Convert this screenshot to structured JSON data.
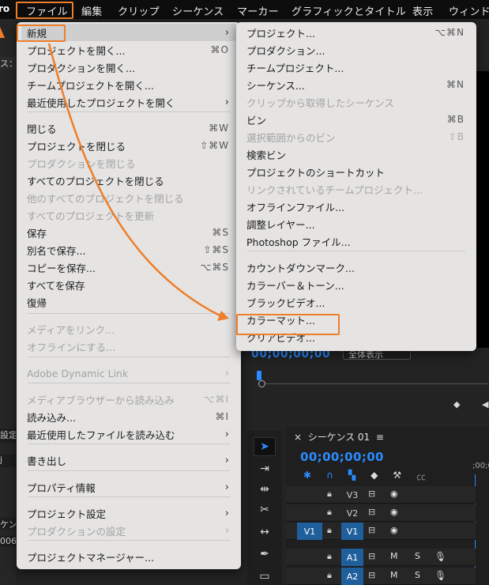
{
  "menubar": {
    "app_partial": "ro",
    "items": [
      "ファイル",
      "編集",
      "クリップ",
      "シーケンス",
      "マーカー",
      "グラフィックとタイトル",
      "表示",
      "ウィンド"
    ]
  },
  "background": {
    "left_cells": [
      "ス：(",
      "設定",
      "j",
      "ケンス",
      "006."
    ],
    "program_timecode": "00;00;00;00",
    "zoom_select": "全体表示",
    "sequence": {
      "tab_label": "シーケンス 01",
      "timecode": "00;00;00;00",
      "ruler_tc": ";00;0",
      "tracks": [
        {
          "name": "V3",
          "src": "",
          "c3": "",
          "c4": "",
          "c5": ""
        },
        {
          "name": "V2",
          "src": "",
          "c3": "",
          "c4": "",
          "c5": ""
        },
        {
          "name": "V1",
          "src": "V1",
          "c3": "",
          "c4": "",
          "c5": ""
        },
        {
          "name": "A1",
          "src": "",
          "c3": "M",
          "c4": "S",
          "c5": ""
        },
        {
          "name": "A2",
          "src": "",
          "c3": "M",
          "c4": "S",
          "c5": ""
        }
      ]
    },
    "accent_color": "#2b8bff"
  },
  "file_menu": {
    "items": [
      {
        "label": "新規",
        "shortcut": "",
        "arrow": "›",
        "disabled": false
      },
      {
        "label": "プロジェクトを開く...",
        "shortcut": "⌘O",
        "arrow": "",
        "disabled": false
      },
      {
        "label": "プロダクションを開く...",
        "shortcut": "",
        "arrow": "",
        "disabled": false
      },
      {
        "label": "チームプロジェクトを開く...",
        "shortcut": "",
        "arrow": "",
        "disabled": false
      },
      {
        "label": "最近使用したプロジェクトを開く",
        "shortcut": "",
        "arrow": "›",
        "disabled": false
      },
      {
        "label": "閉じる",
        "shortcut": "⌘W",
        "arrow": "",
        "disabled": false
      },
      {
        "label": "プロジェクトを閉じる",
        "shortcut": "⇧⌘W",
        "arrow": "",
        "disabled": false
      },
      {
        "label": "プロダクションを閉じる",
        "shortcut": "",
        "arrow": "",
        "disabled": true
      },
      {
        "label": "すべてのプロジェクトを閉じる",
        "shortcut": "",
        "arrow": "",
        "disabled": false
      },
      {
        "label": "他のすべてのプロジェクトを閉じる",
        "shortcut": "",
        "arrow": "",
        "disabled": true
      },
      {
        "label": "すべてのプロジェクトを更新",
        "shortcut": "",
        "arrow": "",
        "disabled": true
      },
      {
        "label": "保存",
        "shortcut": "⌘S",
        "arrow": "",
        "disabled": false
      },
      {
        "label": "別名で保存...",
        "shortcut": "⇧⌘S",
        "arrow": "",
        "disabled": false
      },
      {
        "label": "コピーを保存...",
        "shortcut": "⌥⌘S",
        "arrow": "",
        "disabled": false
      },
      {
        "label": "すべてを保存",
        "shortcut": "",
        "arrow": "",
        "disabled": false
      },
      {
        "label": "復帰",
        "shortcut": "",
        "arrow": "",
        "disabled": false
      },
      {
        "label": "メディアをリンク...",
        "shortcut": "",
        "arrow": "",
        "disabled": true
      },
      {
        "label": "オフラインにする...",
        "shortcut": "",
        "arrow": "",
        "disabled": true
      },
      {
        "label": "Adobe Dynamic Link",
        "shortcut": "",
        "arrow": "›",
        "disabled": true
      },
      {
        "label": "メディアブラウザーから読み込み",
        "shortcut": "⌥⌘I",
        "arrow": "",
        "disabled": true
      },
      {
        "label": "読み込み...",
        "shortcut": "⌘I",
        "arrow": "",
        "disabled": false
      },
      {
        "label": "最近使用したファイルを読み込む",
        "shortcut": "",
        "arrow": "›",
        "disabled": false
      },
      {
        "label": "書き出し",
        "shortcut": "",
        "arrow": "›",
        "disabled": false
      },
      {
        "label": "プロパティ情報",
        "shortcut": "",
        "arrow": "›",
        "disabled": false
      },
      {
        "label": "プロジェクト設定",
        "shortcut": "",
        "arrow": "›",
        "disabled": false
      },
      {
        "label": "プロダクションの設定",
        "shortcut": "",
        "arrow": "›",
        "disabled": true
      },
      {
        "label": "プロジェクトマネージャー...",
        "shortcut": "",
        "arrow": "",
        "disabled": false
      }
    ]
  },
  "new_submenu": {
    "items": [
      {
        "label": "プロジェクト...",
        "shortcut": "⌥⌘N",
        "disabled": false
      },
      {
        "label": "プロダクション...",
        "shortcut": "",
        "disabled": false
      },
      {
        "label": "チームプロジェクト...",
        "shortcut": "",
        "disabled": false
      },
      {
        "label": "シーケンス...",
        "shortcut": "⌘N",
        "disabled": false
      },
      {
        "label": "クリップから取得したシーケンス",
        "shortcut": "",
        "disabled": true
      },
      {
        "label": "ビン",
        "shortcut": "⌘B",
        "disabled": false
      },
      {
        "label": "選択範囲からのビン",
        "shortcut": "⇧B",
        "disabled": true
      },
      {
        "label": "検索ビン",
        "shortcut": "",
        "disabled": false
      },
      {
        "label": "プロジェクトのショートカット",
        "shortcut": "",
        "disabled": false
      },
      {
        "label": "リンクされているチームプロジェクト...",
        "shortcut": "",
        "disabled": true
      },
      {
        "label": "オフラインファイル...",
        "shortcut": "",
        "disabled": false
      },
      {
        "label": "調整レイヤー...",
        "shortcut": "",
        "disabled": false
      },
      {
        "label": "Photoshop ファイル...",
        "shortcut": "",
        "disabled": false
      },
      {
        "label": "カウントダウンマーク...",
        "shortcut": "",
        "disabled": false
      },
      {
        "label": "カラーバー＆トーン...",
        "shortcut": "",
        "disabled": false
      },
      {
        "label": "ブラックビデオ...",
        "shortcut": "",
        "disabled": false
      },
      {
        "label": "カラーマット...",
        "shortcut": "",
        "disabled": false
      },
      {
        "label": "クリアビデオ...",
        "shortcut": "",
        "disabled": false
      }
    ]
  },
  "highlight_color": "#ee7e2a"
}
